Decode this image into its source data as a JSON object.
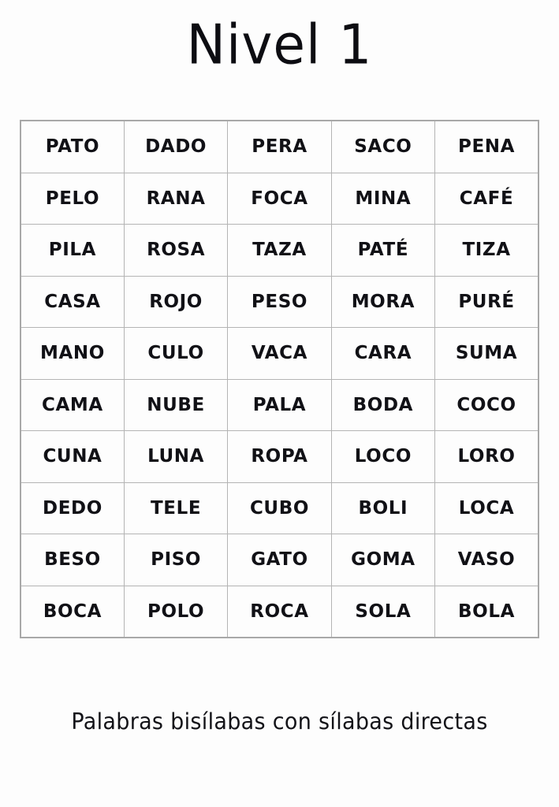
{
  "page": {
    "title": "Nivel 1",
    "caption": "Palabras bisílabas con sílabas directas",
    "background_color": "#fdfdfd",
    "text_color": "#111116",
    "table_border_color": "#b4b4b4"
  },
  "word_table": {
    "columns": 5,
    "rows": 10,
    "cells": [
      [
        "PATO",
        "DADO",
        "PERA",
        "SACO",
        "PENA"
      ],
      [
        "PELO",
        "RANA",
        "FOCA",
        "MINA",
        "CAFÉ"
      ],
      [
        "PILA",
        "ROSA",
        "TAZA",
        "PATÉ",
        "TIZA"
      ],
      [
        "CASA",
        "ROJO",
        "PESO",
        "MORA",
        "PURÉ"
      ],
      [
        "MANO",
        "CULO",
        "VACA",
        "CARA",
        "SUMA"
      ],
      [
        "CAMA",
        "NUBE",
        "PALA",
        "BODA",
        "COCO"
      ],
      [
        "CUNA",
        "LUNA",
        "ROPA",
        "LOCO",
        "LORO"
      ],
      [
        "DEDO",
        "TELE",
        "CUBO",
        "BOLI",
        "LOCA"
      ],
      [
        "BESO",
        "PISO",
        "GATO",
        "GOMA",
        "VASO"
      ],
      [
        "BOCA",
        "POLO",
        "ROCA",
        "SOLA",
        "BOLA"
      ]
    ]
  }
}
